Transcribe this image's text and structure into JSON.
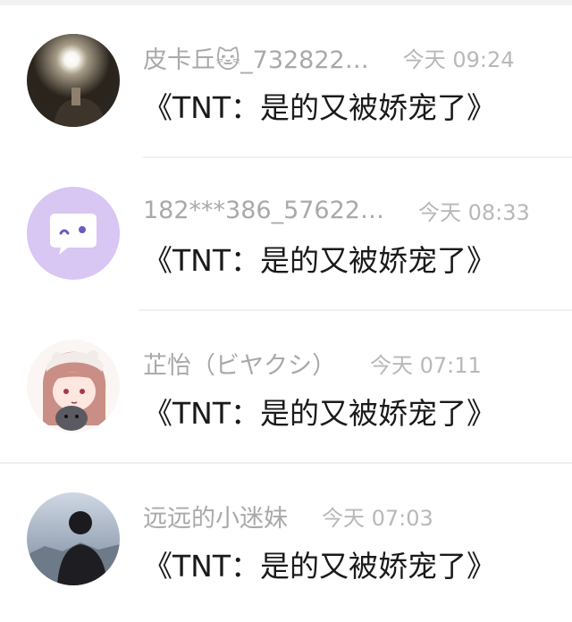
{
  "comments": [
    {
      "name": "皮卡丘🐱_732822…",
      "time": "今天 09:24",
      "text": "《TNT：是的又被娇宠了》",
      "avatar_icon": "flash-selfie-photo"
    },
    {
      "name": "182***386_57622…",
      "time": "今天 08:33",
      "text": "《TNT：是的又被娇宠了》",
      "avatar_icon": "chat-bubble-default-avatar"
    },
    {
      "name": "芷怡（ビヤクシ）",
      "time": "今天 07:11",
      "text": "《TNT：是的又被娇宠了》",
      "avatar_icon": "anime-girl-avatar"
    },
    {
      "name": "远远的小迷妹",
      "time": "今天 07:03",
      "text": "《TNT：是的又被娇宠了》",
      "avatar_icon": "silhouette-photo-avatar"
    }
  ],
  "colors": {
    "name": "#a9a9a9",
    "time": "#b8b8b8",
    "text": "#1a1a1a",
    "default_avatar_bg": "#d8c6f3"
  }
}
